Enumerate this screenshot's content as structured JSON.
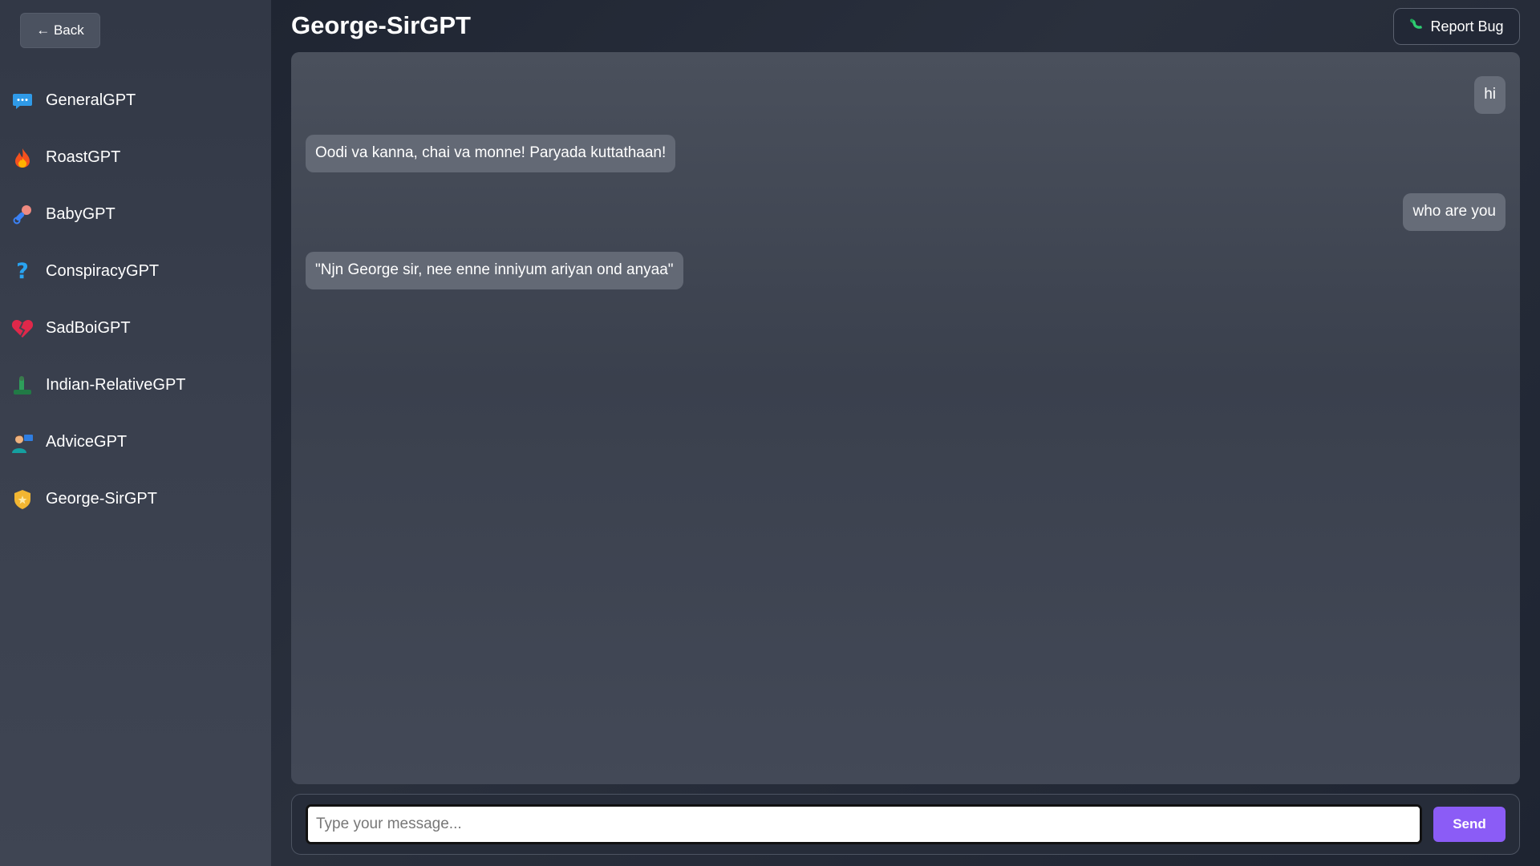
{
  "sidebar": {
    "back_label": "← Back",
    "items": [
      {
        "label": "GeneralGPT",
        "icon": "speech-bubble-icon"
      },
      {
        "label": "RoastGPT",
        "icon": "fire-icon"
      },
      {
        "label": "BabyGPT",
        "icon": "pacifier-icon"
      },
      {
        "label": "ConspiracyGPT",
        "icon": "question-mark-icon"
      },
      {
        "label": "SadBoiGPT",
        "icon": "broken-heart-icon"
      },
      {
        "label": "Indian-RelativeGPT",
        "icon": "relative-icon"
      },
      {
        "label": "AdviceGPT",
        "icon": "advisor-icon"
      },
      {
        "label": "George-SirGPT",
        "icon": "badge-icon"
      }
    ]
  },
  "header": {
    "title": "George-SirGPT",
    "report_bug_label": "Report Bug"
  },
  "chat": {
    "messages": [
      {
        "role": "user",
        "text": "hi"
      },
      {
        "role": "bot",
        "text": "Oodi va kanna, chai va monne! Paryada kuttathaan!"
      },
      {
        "role": "user",
        "text": "who are you"
      },
      {
        "role": "bot",
        "text": "\"Njn George sir, nee enne inniyum ariyan ond anyaa\""
      }
    ]
  },
  "composer": {
    "placeholder": "Type your message...",
    "value": "",
    "send_label": "Send"
  },
  "colors": {
    "accent": "#8b5cf6",
    "bubble": "#636975",
    "panel": "#434957"
  }
}
